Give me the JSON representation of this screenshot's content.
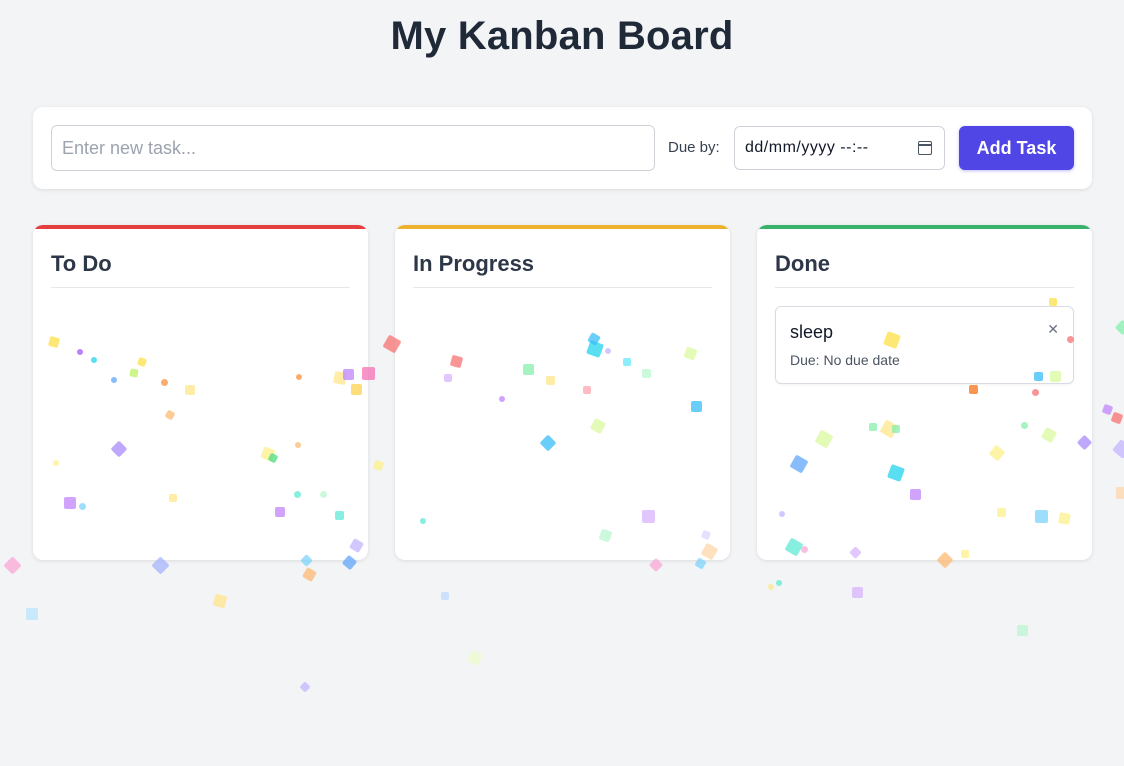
{
  "header": {
    "title": "My Kanban Board"
  },
  "form": {
    "placeholder": "Enter new task...",
    "due_label": "Due by:",
    "due_value": "dd/mm/yyyy --:--",
    "add_label": "Add Task"
  },
  "columns": [
    {
      "title": "To Do",
      "accent": "#e53e3e",
      "tasks": []
    },
    {
      "title": "In Progress",
      "accent": "#ecb22e",
      "tasks": []
    },
    {
      "title": "Done",
      "accent": "#38b26a",
      "tasks": [
        {
          "title": "sleep",
          "due": "Due: No due date"
        }
      ]
    }
  ],
  "colors": {
    "page_bg": "#f3f4f6",
    "primary_button": "#4f46e5"
  },
  "icons": {
    "delete": "close-icon",
    "calendar": "calendar-icon"
  }
}
